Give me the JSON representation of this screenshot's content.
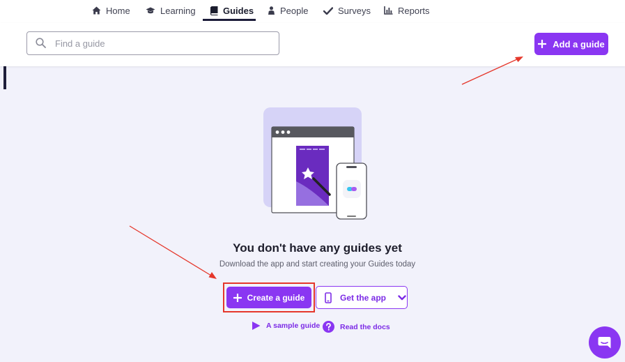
{
  "nav": {
    "items": [
      {
        "label": "Home",
        "icon": "home-icon"
      },
      {
        "label": "Learning",
        "icon": "graduation-cap-icon"
      },
      {
        "label": "Guides",
        "icon": "book-icon",
        "active": true
      },
      {
        "label": "People",
        "icon": "person-icon"
      },
      {
        "label": "Surveys",
        "icon": "check-icon"
      },
      {
        "label": "Reports",
        "icon": "bar-chart-icon"
      }
    ]
  },
  "search": {
    "placeholder": "Find a guide",
    "value": ""
  },
  "toolbar": {
    "add_label": "Add a guide"
  },
  "empty_state": {
    "title": "You don't have any guides yet",
    "subtitle": "Download the app and start creating your Guides today",
    "create_label": "Create a guide",
    "get_app_label": "Get the app",
    "sample_link": "A sample guide",
    "docs_link": "Read the docs"
  },
  "colors": {
    "accent": "#8a36f2",
    "annotation": "#e5372b",
    "background": "#f2f2fb"
  }
}
